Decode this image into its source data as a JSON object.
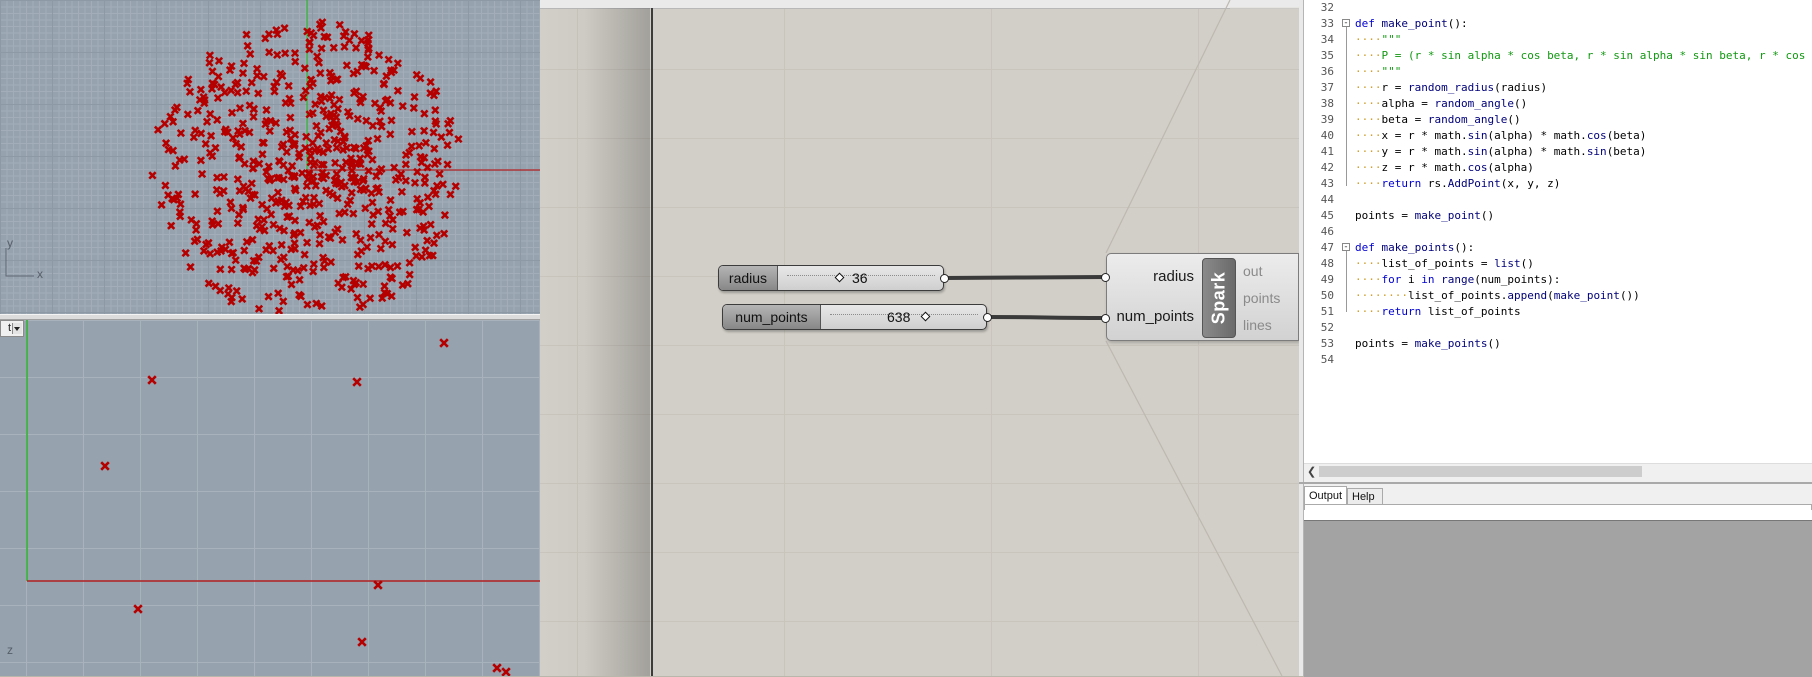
{
  "viewports": {
    "top": {
      "axis_x_label": "x",
      "axis_y_label": "y"
    },
    "front": {
      "tab_label": "t",
      "axis_z_label": "z"
    },
    "colors": {
      "point": "#b50000",
      "x_axis": "#b02020",
      "y_axis": "#2cb52c"
    }
  },
  "grasshopper": {
    "sliders": [
      {
        "name": "radius",
        "value": "36"
      },
      {
        "name": "num_points",
        "value": "638"
      }
    ],
    "component": {
      "name": "Spark",
      "inputs": [
        "radius",
        "num_points"
      ],
      "outputs": [
        "out",
        "points",
        "lines"
      ]
    }
  },
  "editor": {
    "lines": [
      {
        "num": "32",
        "fold": "",
        "indent": "",
        "parts": []
      },
      {
        "num": "33",
        "fold": "⊟",
        "indent": "",
        "parts": [
          [
            "kw",
            "def "
          ],
          [
            "fn",
            "make_point"
          ],
          [
            "plain",
            "():"
          ]
        ]
      },
      {
        "num": "34",
        "fold": "",
        "indent": "····",
        "parts": [
          [
            "str",
            "\"\"\""
          ]
        ]
      },
      {
        "num": "35",
        "fold": "",
        "indent": "····",
        "parts": [
          [
            "str",
            "P = (r * sin alpha * cos beta, r * sin alpha * sin beta, r * cos alpha)"
          ]
        ]
      },
      {
        "num": "36",
        "fold": "",
        "indent": "····",
        "parts": [
          [
            "str",
            "\"\"\""
          ]
        ]
      },
      {
        "num": "37",
        "fold": "",
        "indent": "····",
        "parts": [
          [
            "plain",
            "r = "
          ],
          [
            "fn",
            "random_radius"
          ],
          [
            "plain",
            "(radius)"
          ]
        ]
      },
      {
        "num": "38",
        "fold": "",
        "indent": "····",
        "parts": [
          [
            "plain",
            "alpha = "
          ],
          [
            "fn",
            "random_angle"
          ],
          [
            "plain",
            "()"
          ]
        ]
      },
      {
        "num": "39",
        "fold": "",
        "indent": "····",
        "parts": [
          [
            "plain",
            "beta = "
          ],
          [
            "fn",
            "random_angle"
          ],
          [
            "plain",
            "()"
          ]
        ]
      },
      {
        "num": "40",
        "fold": "",
        "indent": "····",
        "parts": [
          [
            "plain",
            "x = r * math."
          ],
          [
            "fn",
            "sin"
          ],
          [
            "plain",
            "(alpha) * math."
          ],
          [
            "fn",
            "cos"
          ],
          [
            "plain",
            "(beta)"
          ]
        ]
      },
      {
        "num": "41",
        "fold": "",
        "indent": "····",
        "parts": [
          [
            "plain",
            "y = r * math."
          ],
          [
            "fn",
            "sin"
          ],
          [
            "plain",
            "(alpha) * math."
          ],
          [
            "fn",
            "sin"
          ],
          [
            "plain",
            "(beta)"
          ]
        ]
      },
      {
        "num": "42",
        "fold": "",
        "indent": "····",
        "parts": [
          [
            "plain",
            "z = r * math."
          ],
          [
            "fn",
            "cos"
          ],
          [
            "plain",
            "(alpha)"
          ]
        ]
      },
      {
        "num": "43",
        "fold": "",
        "indent": "····",
        "parts": [
          [
            "kw",
            "return "
          ],
          [
            "plain",
            "rs."
          ],
          [
            "fn",
            "AddPoint"
          ],
          [
            "plain",
            "(x, y, z)"
          ]
        ]
      },
      {
        "num": "44",
        "fold": "",
        "indent": "",
        "parts": []
      },
      {
        "num": "45",
        "fold": "",
        "indent": "",
        "parts": [
          [
            "plain",
            "points = "
          ],
          [
            "fn",
            "make_point"
          ],
          [
            "plain",
            "()"
          ]
        ]
      },
      {
        "num": "46",
        "fold": "",
        "indent": "",
        "parts": []
      },
      {
        "num": "47",
        "fold": "⊟",
        "indent": "",
        "parts": [
          [
            "kw",
            "def "
          ],
          [
            "fn",
            "make_points"
          ],
          [
            "plain",
            "():"
          ]
        ]
      },
      {
        "num": "48",
        "fold": "",
        "indent": "····",
        "parts": [
          [
            "plain",
            "list_of_points = "
          ],
          [
            "fn",
            "list"
          ],
          [
            "plain",
            "()"
          ]
        ]
      },
      {
        "num": "49",
        "fold": "",
        "indent": "····",
        "parts": [
          [
            "kw",
            "for "
          ],
          [
            "plain",
            "i "
          ],
          [
            "kw",
            "in "
          ],
          [
            "fn",
            "range"
          ],
          [
            "plain",
            "(num_points):"
          ]
        ]
      },
      {
        "num": "50",
        "fold": "",
        "indent": "········",
        "parts": [
          [
            "plain",
            "list_of_points."
          ],
          [
            "fn",
            "append"
          ],
          [
            "plain",
            "("
          ],
          [
            "fn",
            "make_point"
          ],
          [
            "plain",
            "())"
          ]
        ]
      },
      {
        "num": "51",
        "fold": "",
        "indent": "····",
        "parts": [
          [
            "kw",
            "return "
          ],
          [
            "plain",
            "list_of_points"
          ]
        ]
      },
      {
        "num": "52",
        "fold": "",
        "indent": "",
        "parts": []
      },
      {
        "num": "53",
        "fold": "",
        "indent": "",
        "parts": [
          [
            "plain",
            "points = "
          ],
          [
            "fn",
            "make_points"
          ],
          [
            "plain",
            "()"
          ]
        ]
      },
      {
        "num": "54",
        "fold": "",
        "indent": "",
        "parts": []
      }
    ],
    "tabs": {
      "output": "Output",
      "help": "Help"
    }
  }
}
